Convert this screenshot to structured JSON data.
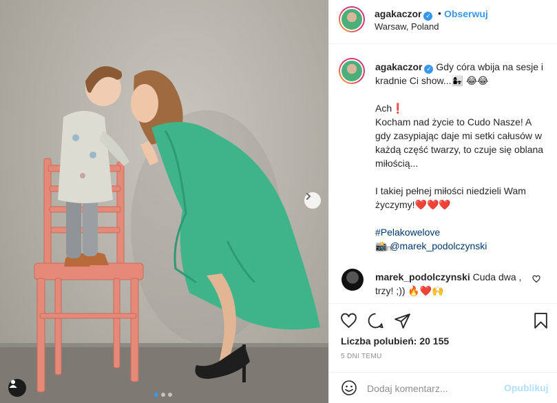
{
  "post": {
    "author": "agakaczor",
    "separator": "•",
    "follow_label": "Obserwuj",
    "location": "Warsaw, Poland",
    "caption": {
      "headline": "Gdy córa wbija na sesje i kradnie Ci show...👩‍👧 😂😂",
      "line1": "Ach❗️",
      "line2": "Kocham nad życie to Cudo Nasze! A gdy zasypiając daje mi setki całusów w każdą część twarzy, to czuje się oblana miłością...",
      "line3": "I takiej pełnej miłości niedzieli Wam życzymy!❤️❤️❤️",
      "hashtag": "#Pelakowelove",
      "camera_emoji": "📸",
      "photographer": "@marek_podolczynski",
      "time": "5 dni"
    },
    "comment": {
      "user": "marek_podolczynski",
      "text": "Cuda dwa , trzy! ;)) 🔥❤️🙌"
    },
    "likes_text": "Liczba polubień: 20 155",
    "time_ago": "5 DNI TEMU",
    "add_comment": {
      "placeholder": "Dodaj komentarz...",
      "publish_label": "Opublikuj"
    },
    "carousel": {
      "slides": 3,
      "active": 1
    },
    "colors": {
      "accent": "#3897f0",
      "text": "#262626",
      "muted": "#8e8e8e",
      "publish_disabled": "#b2dffc",
      "dress": "#3fb48a",
      "chair": "#e58979"
    },
    "icons": [
      "verified-icon",
      "chevron-right-icon",
      "user-tag-icon",
      "heart-icon",
      "comment-icon",
      "share-icon",
      "bookmark-icon",
      "emoji-icon"
    ]
  }
}
